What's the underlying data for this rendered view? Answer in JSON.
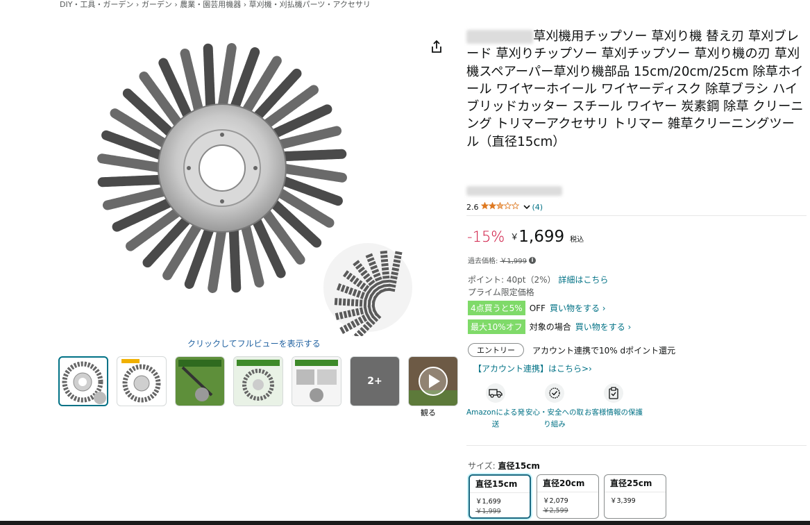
{
  "breadcrumb": {
    "text": "DIY・工具・ガーデン › ガーデン › 農業・園芸用機器 › 草刈機・刈払機パーツ・アクセサリ"
  },
  "gallery": {
    "full_view_label": "クリックしてフルビューを表示する",
    "more_count": "2+",
    "video_label": "観る"
  },
  "product": {
    "title": "草刈機用チップソー 草刈り機 替え刃 草刈ブレード 草刈りチップソー 草刈チップソー 草刈り機の刃 草刈機スペアーパー草刈り機部品 15cm/20cm/25cm 除草ホイール ワイヤーホイール ワイヤーディスク 除草ブラシ ハイブリッドカッター スチール ワイヤー 炭素鋼 除草 クリーニング トリマーアクセサリ トリマー 雑草クリーニングツール（直径15cm）",
    "rating_value": "2.6",
    "rating_stars": 2.5,
    "rating_count": "(4)"
  },
  "price": {
    "discount": "-15%",
    "currency": "￥",
    "amount": "1,699",
    "tax_label": "税込",
    "past_label": "過去価格:",
    "past_price": "￥1,999"
  },
  "points": {
    "label": "ポイント: 40pt（2%）",
    "link": "詳細はこちら",
    "prime_label": "プライム限定価格"
  },
  "promos": [
    {
      "badge": "4点買うと5%",
      "text": "OFF",
      "link": "買い物をする ›"
    },
    {
      "badge": "最大10%オフ",
      "text": "対象の場合",
      "link": "買い物をする ›"
    }
  ],
  "entry": {
    "button": "エントリー",
    "text": "アカウント連携で10% dポイント還元",
    "link": "【アカウント連携】はこちら>›"
  },
  "trust": [
    {
      "icon": "delivery-truck-icon",
      "label": "Amazonによる発送"
    },
    {
      "icon": "secure-badge-icon",
      "label": "安心・安全への取り組み"
    },
    {
      "icon": "secure-clipboard-icon",
      "label": "お客様情報の保護"
    }
  ],
  "sizes": {
    "label": "サイズ:",
    "selected": "直径15cm",
    "options": [
      {
        "name": "直径15cm",
        "price": "￥1,699",
        "old": "￥1,999"
      },
      {
        "name": "直径20cm",
        "price": "￥2,079",
        "old": "￥2,599"
      },
      {
        "name": "直径25cm",
        "price": "￥3,399",
        "old": ""
      }
    ]
  },
  "colors": {
    "discount": "#cc0c39",
    "link": "#007185",
    "promo_badge": "#7fda69",
    "selected_border": "#1a6880"
  }
}
